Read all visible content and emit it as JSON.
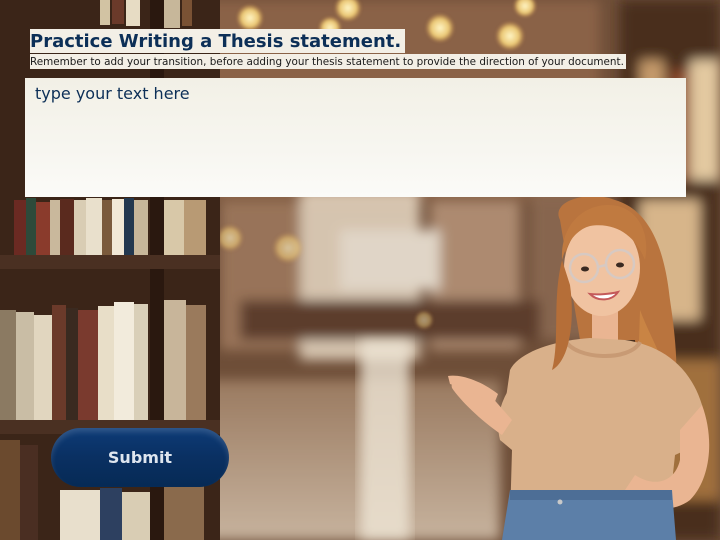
{
  "header": {
    "title": "Practice Writing a Thesis statement.",
    "subtitle": "Remember to add your transition, before adding your thesis statement to provide the direction of your document."
  },
  "input": {
    "placeholder": "type your text here",
    "value": ""
  },
  "actions": {
    "submit_label": "Submit"
  },
  "colors": {
    "title": "#0c2f57",
    "button": "#0a3062",
    "text_bg": "#f4f2ea"
  },
  "images": {
    "background": "library-bookshelf-background",
    "person": "smiling-woman-presenting"
  }
}
